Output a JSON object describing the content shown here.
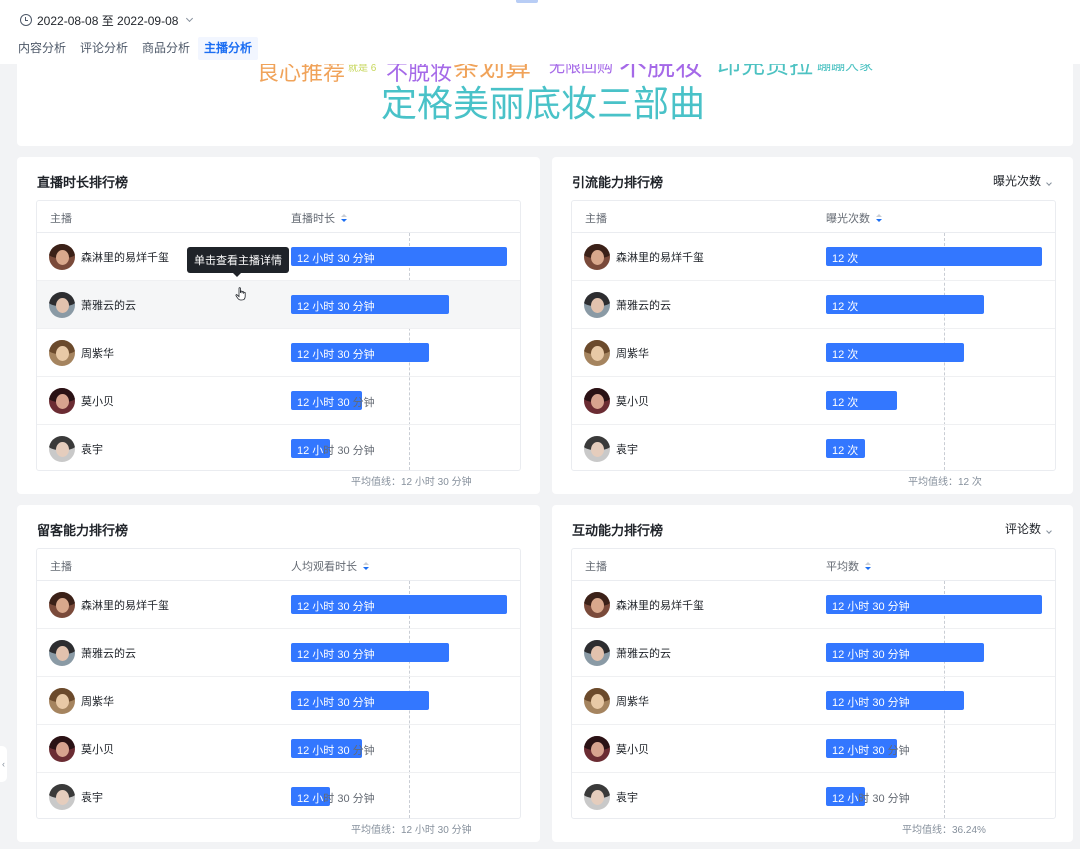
{
  "header": {
    "date_range": "2022-08-08 至 2022-09-08",
    "tabs": [
      "内容分析",
      "评论分析",
      "商品分析",
      "主播分析"
    ],
    "active_tab": 3
  },
  "word_cloud": [
    {
      "text": "良心推荐",
      "color": "#f0a35a"
    },
    {
      "text": "就是 6",
      "color": "#c6d65a"
    },
    {
      "text": "不脱妆",
      "color": "#a569e8"
    },
    {
      "text": "条划算",
      "color": "#f0a35a"
    },
    {
      "text": "无限回购",
      "color": "#a569e8"
    },
    {
      "text": "不脱妆",
      "color": "#a569e8"
    },
    {
      "text": "印充货拉",
      "color": "#4dc2c2"
    },
    {
      "text": "蹦蹦大家",
      "color": "#4dc2c2"
    },
    {
      "text": "定格美丽底妆三部曲",
      "color": "#49c2c8"
    }
  ],
  "icons": {
    "clock": "clock-icon",
    "dropdown": "chevron-down-icon",
    "sort": "sort-icon",
    "cursor": "hand-pointer-icon",
    "side": "chevron-left-icon"
  },
  "colors": {
    "bar": "#3377ff",
    "accent": "#1b6ef3"
  },
  "tooltip": "单击查看主播详情",
  "side_handle": "‹",
  "panels": [
    {
      "title": "直播时长排行榜",
      "selector": "",
      "col_name": "主播",
      "col_metric": "直播时长",
      "avg_label": "平均值线：12 小时 30 分钟",
      "rows": [
        {
          "name": "森淋里的易烊千玺",
          "value_text": "12 小时 30 分钟",
          "fraction": 1.0
        },
        {
          "name": "萧雅云的云",
          "value_text": "12 小时 30 分钟",
          "fraction": 0.73
        },
        {
          "name": "周紫华",
          "value_text": "12 小时 30 分钟",
          "fraction": 0.64
        },
        {
          "name": "莫小贝",
          "value_text": "12 小时 30 分钟",
          "fraction": 0.33
        },
        {
          "name": "袁宇",
          "value_text": "12 小时 30 分钟",
          "fraction": 0.18
        }
      ]
    },
    {
      "title": "引流能力排行榜",
      "selector": "曝光次数",
      "col_name": "主播",
      "col_metric": "曝光次数",
      "avg_label": "平均值线：12 次",
      "rows": [
        {
          "name": "森淋里的易烊千玺",
          "value_text": "12 次",
          "fraction": 1.0
        },
        {
          "name": "萧雅云的云",
          "value_text": "12 次",
          "fraction": 0.73
        },
        {
          "name": "周紫华",
          "value_text": "12 次",
          "fraction": 0.64
        },
        {
          "name": "莫小贝",
          "value_text": "12 次",
          "fraction": 0.33
        },
        {
          "name": "袁宇",
          "value_text": "12 次",
          "fraction": 0.18
        }
      ]
    },
    {
      "title": "留客能力排行榜",
      "selector": "",
      "col_name": "主播",
      "col_metric": "人均观看时长",
      "avg_label": "平均值线：12 小时 30 分钟",
      "rows": [
        {
          "name": "森淋里的易烊千玺",
          "value_text": "12 小时 30 分钟",
          "fraction": 1.0
        },
        {
          "name": "萧雅云的云",
          "value_text": "12 小时 30 分钟",
          "fraction": 0.73
        },
        {
          "name": "周紫华",
          "value_text": "12 小时 30 分钟",
          "fraction": 0.64
        },
        {
          "name": "莫小贝",
          "value_text": "12 小时 30 分钟",
          "fraction": 0.33
        },
        {
          "name": "袁宇",
          "value_text": "12 小时 30 分钟",
          "fraction": 0.18
        }
      ]
    },
    {
      "title": "互动能力排行榜",
      "selector": "评论数",
      "col_name": "主播",
      "col_metric": "平均数",
      "avg_label": "平均值线：36.24%",
      "rows": [
        {
          "name": "森淋里的易烊千玺",
          "value_text": "12 小时 30 分钟",
          "fraction": 1.0
        },
        {
          "name": "萧雅云的云",
          "value_text": "12 小时 30 分钟",
          "fraction": 0.73
        },
        {
          "name": "周紫华",
          "value_text": "12 小时 30 分钟",
          "fraction": 0.64
        },
        {
          "name": "莫小贝",
          "value_text": "12 小时 30 分钟",
          "fraction": 0.33
        },
        {
          "name": "袁宇",
          "value_text": "12 小时 30 分钟",
          "fraction": 0.18
        }
      ]
    }
  ]
}
